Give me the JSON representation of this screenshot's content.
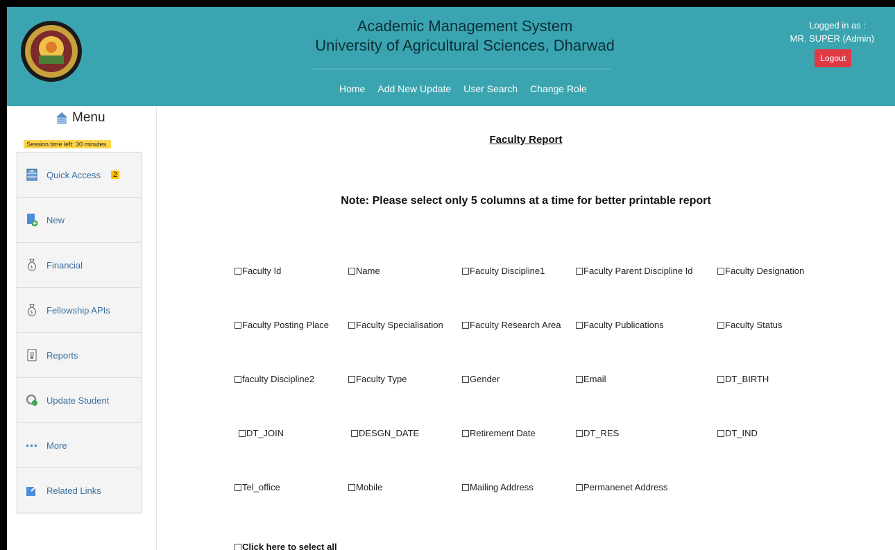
{
  "header": {
    "title_line1": "Academic Management System",
    "title_line2": "University of Agricultural Sciences, Dharwad",
    "nav": [
      "Home",
      "Add New Update",
      "User Search",
      "Change Role"
    ],
    "logged_in_label": "Logged in as :",
    "user": "MR. SUPER (Admin)",
    "logout_label": "Logout"
  },
  "sidebar": {
    "menu_title": "Menu",
    "session_text": "Session time left: 30 minutes.",
    "items": [
      {
        "label": "Quick Access",
        "badge": "2",
        "icon": "folder-icon"
      },
      {
        "label": "New",
        "icon": "new-document-icon"
      },
      {
        "label": "Financial",
        "icon": "money-bag-icon"
      },
      {
        "label": "Fellowship APIs",
        "icon": "money-bag-icon"
      },
      {
        "label": "Reports",
        "icon": "report-icon"
      },
      {
        "label": "Update Student",
        "icon": "update-icon"
      },
      {
        "label": "More",
        "icon": "more-dots-icon"
      },
      {
        "label": "Related Links",
        "icon": "external-link-icon"
      }
    ]
  },
  "main": {
    "report_title": "Faculty Report",
    "note": "Note: Please select only 5 columns at a time for better printable report",
    "columns": [
      [
        "Faculty Id",
        "Name",
        "Faculty Discipline1",
        "Faculty Parent Discipline Id",
        "Faculty Designation"
      ],
      [
        "Faculty Posting Place",
        "Faculty Specialisation",
        "Faculty Research Area",
        "Faculty Publications",
        "Faculty Status"
      ],
      [
        "faculty Discipline2",
        "Faculty Type",
        "Gender",
        "Email",
        "DT_BIRTH"
      ],
      [
        "DT_JOIN",
        "DESGN_DATE",
        "Retirement Date",
        "DT_RES",
        "DT_IND"
      ],
      [
        "Tel_office",
        "Mobile",
        "Mailing Address",
        "Permanenet Address"
      ]
    ],
    "select_all": "Click here to select all"
  },
  "colors": {
    "header_bg": "#3aa5b0",
    "logout_bg": "#e03a45",
    "badge_bg": "#ffc107",
    "link_text": "#3a6fa0"
  }
}
